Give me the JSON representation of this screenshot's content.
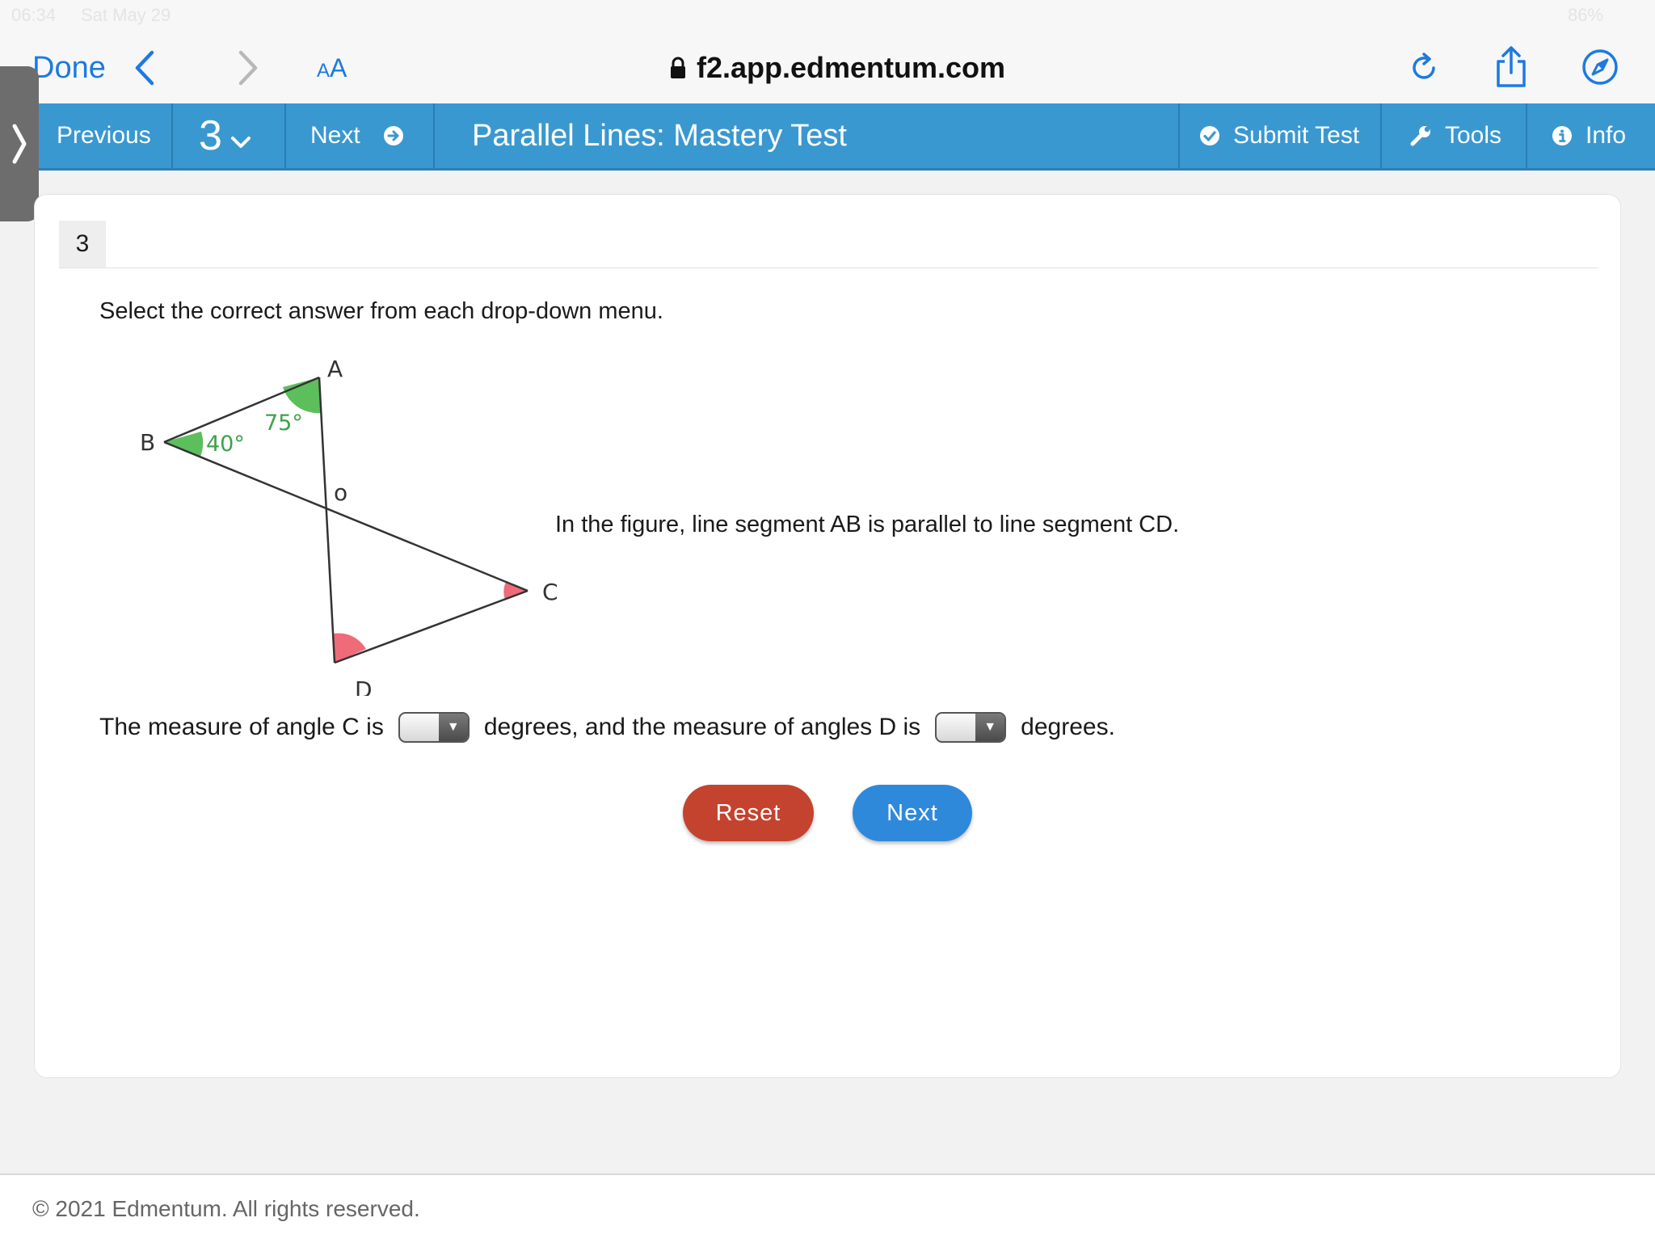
{
  "status": {
    "time": "06:34",
    "date": "Sat May 29",
    "battery": "86%"
  },
  "browser": {
    "done_label": "Done",
    "aa_label_small": "A",
    "aa_label_large": "A",
    "url": "f2.app.edmentum.com"
  },
  "toolbar": {
    "previous_label": "Previous",
    "question_number": "3",
    "next_label": "Next",
    "test_title": "Parallel Lines: Mastery Test",
    "submit_label": "Submit Test",
    "tools_label": "Tools",
    "info_label": "Info",
    "color": "#3a98d0"
  },
  "question": {
    "number": "3",
    "instruction": "Select the correct answer from each drop-down menu.",
    "statement": "In the figure, line segment AB is parallel to line segment CD.",
    "figure": {
      "vertex_labels": {
        "A": "A",
        "B": "B",
        "C": "C",
        "D": "D",
        "O": "o"
      },
      "angle_B": "40°",
      "angle_A": "75°",
      "given_angle_color": "#5cbf5c",
      "unknown_angle_color": "#f06b7a"
    },
    "sentence": {
      "part1": "The measure of angle C is",
      "part2": "degrees, and the measure of angles D is",
      "part3": "degrees."
    },
    "dropdown_c_value": "",
    "dropdown_d_value": ""
  },
  "buttons": {
    "reset_label": "Reset",
    "next_label": "Next",
    "reset_color": "#c4432f",
    "next_color": "#2f89db"
  },
  "footer": {
    "copyright": "© 2021 Edmentum. All rights reserved."
  }
}
